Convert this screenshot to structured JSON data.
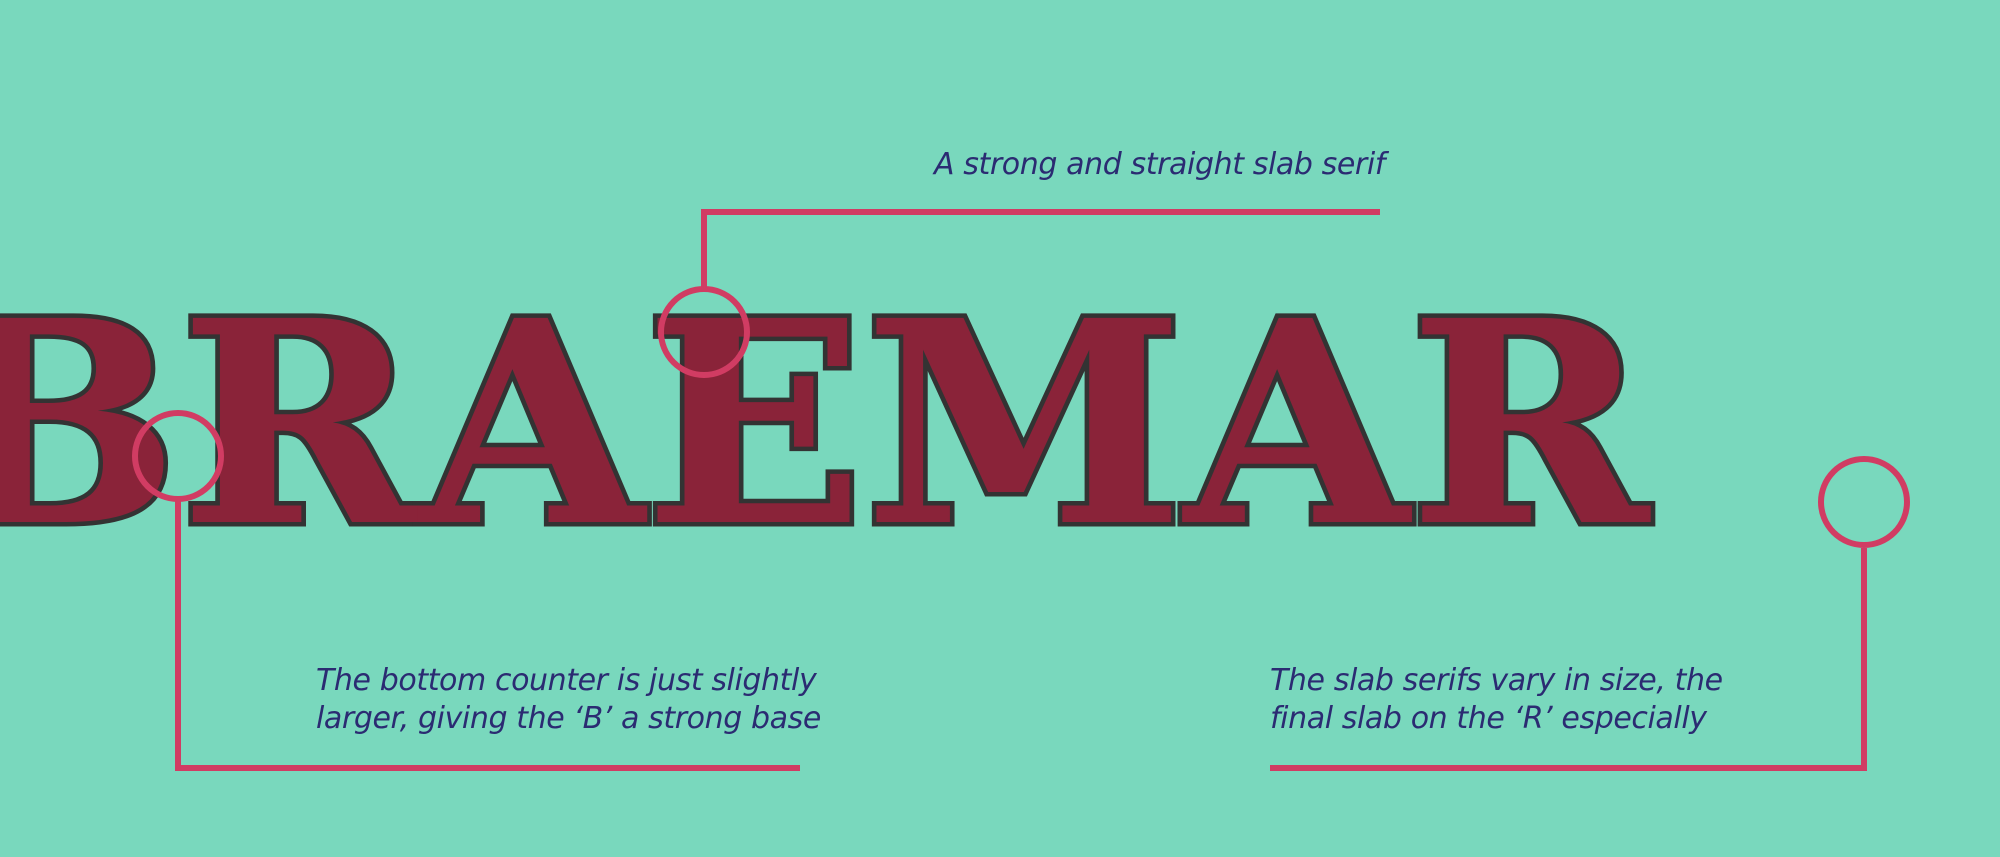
{
  "wordmark": {
    "text": "BRAEMAR",
    "fill_color": "#8a2339",
    "outline_color": "#333333"
  },
  "annotations": [
    {
      "id": "slab-serif",
      "lines": [
        "A strong and straight slab serif"
      ]
    },
    {
      "id": "bottom-counter",
      "lines": [
        "The bottom counter is just slightly",
        "larger, giving the ‘B’ a strong base"
      ]
    },
    {
      "id": "slab-size",
      "lines": [
        "The slab serifs vary in size, the",
        "final slab on the ‘R’ especially"
      ]
    }
  ],
  "colors": {
    "background": "#79d8bd",
    "callout_line": "#d13c63",
    "caption_text": "#2b2b72"
  },
  "icons": {
    "callout_marker": "circle-marker-icon"
  }
}
